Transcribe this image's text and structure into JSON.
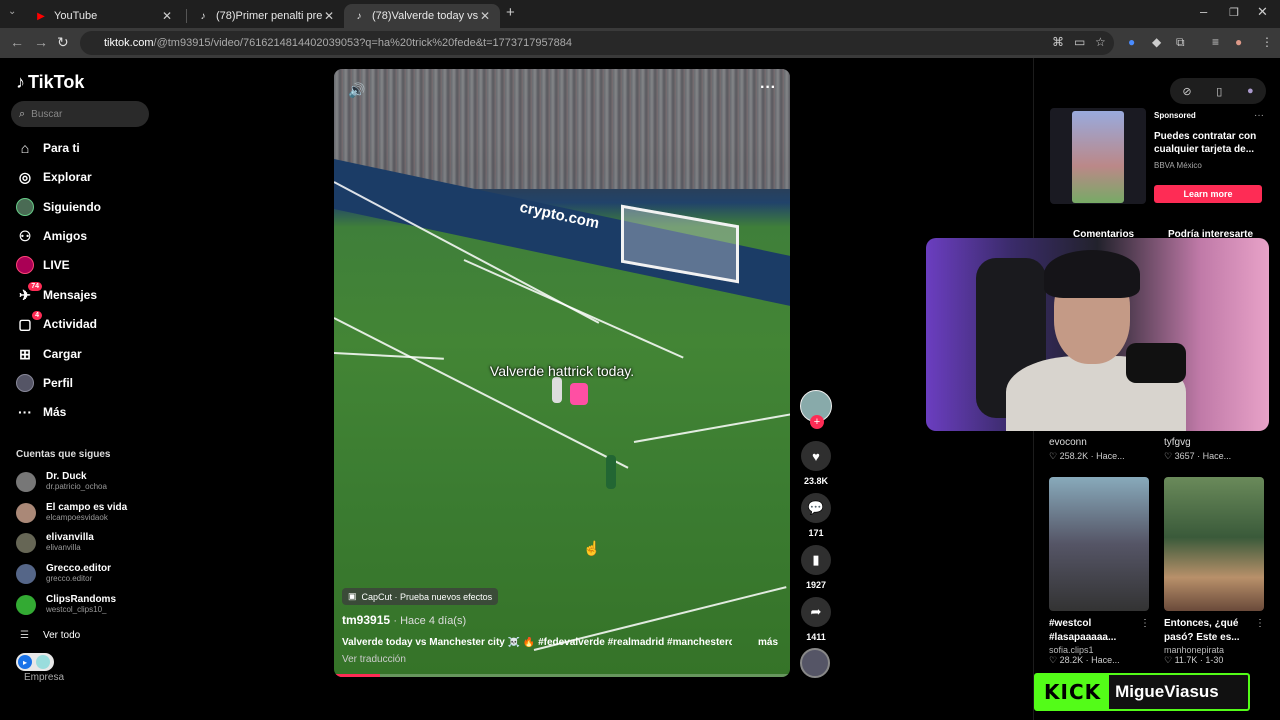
{
  "browser": {
    "tabs": [
      {
        "label": "YouTube",
        "icon": "youtube-icon"
      },
      {
        "label": "(78)Primer penalti presi de Ney",
        "icon": "tiktok-icon"
      },
      {
        "label": "(78)Valverde today vs Manches",
        "icon": "tiktok-icon"
      }
    ],
    "url_host": "tiktok.com",
    "url_path": "/@tm93915/video/7616214814402039053?q=ha%20trick%20fede&t=1773717957884"
  },
  "sidebar": {
    "brand": "TikTok",
    "search_placeholder": "Buscar",
    "nav": [
      {
        "label": "Para ti"
      },
      {
        "label": "Explorar"
      },
      {
        "label": "Siguiendo"
      },
      {
        "label": "Amigos"
      },
      {
        "label": "LIVE"
      },
      {
        "label": "Mensajes",
        "badge": "74"
      },
      {
        "label": "Actividad",
        "badge": "4"
      },
      {
        "label": "Cargar"
      },
      {
        "label": "Perfil"
      },
      {
        "label": "Más"
      }
    ],
    "following_title": "Cuentas que sigues",
    "following": [
      {
        "name": "Dr. Duck",
        "handle": "dr.patricio_ochoa"
      },
      {
        "name": "El campo es vida",
        "handle": "elcampoesvidaok"
      },
      {
        "name": "elivanvilla",
        "handle": "elivanvilla"
      },
      {
        "name": "Grecco.editor",
        "handle": "grecco.editor"
      },
      {
        "name": "ClipsRandoms",
        "handle": "westcol_clips10_"
      }
    ],
    "see_all": "Ver todo",
    "footer": "Empresa"
  },
  "video": {
    "caption_overlay": "Valverde hattrick today.",
    "ad_board": "crypto.com",
    "capcut": "CapCut · Prueba nuevos efectos",
    "author": "tm93915",
    "posted": "· Hace 4 día(s)",
    "description": "Valverde today vs Manchester city ☠️ 🔥 #fedevalverde #realmadrid #manchestercity ...",
    "more": "más",
    "translate": "Ver traducción",
    "progress": 0.1
  },
  "actions": {
    "likes": "23.8K",
    "comments": "171",
    "saves": "1927",
    "shares": "1411"
  },
  "right_panel": {
    "ad": {
      "sponsored": "Sponsored",
      "title": "Puedes contratar con cualquier tarjeta de...",
      "brand": "BBVA México",
      "cta": "Learn more"
    },
    "tabs": [
      "Comentarios",
      "Podría interesarte"
    ],
    "cards_top": [
      {
        "user": "evoconn",
        "stats": "♡ 258.2K · Hace..."
      },
      {
        "user": "tyfgvg",
        "stats": "♡ 3657 · Hace..."
      }
    ],
    "cards": [
      {
        "title": "#westcol #lasapaaaaa...",
        "user": "sofia.clips1",
        "stats": "♡ 28.2K · Hace..."
      },
      {
        "title": "Entonces, ¿qué pasó? Este es...",
        "user": "manhonepirata",
        "stats": "♡ 11.7K · 1-30"
      }
    ]
  },
  "overlay": {
    "kick_logo": "KICK",
    "kick_name": "MigueViasus"
  },
  "colors": {
    "accent": "#fe2c55",
    "kick": "#53fc18"
  }
}
